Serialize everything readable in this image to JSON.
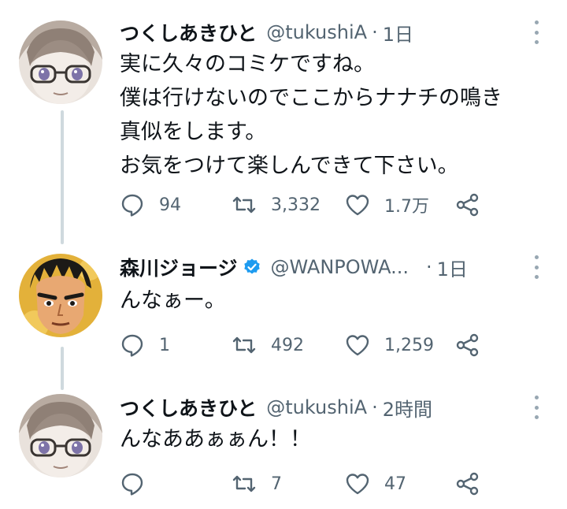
{
  "tweets": [
    {
      "name": "つくしあきひと",
      "handle": "@tukushiA",
      "time": "1日",
      "text": "実に久々のコミケですね。\n僕は行けないのでここからナナチの鳴き\n真似をします。\nお気をつけて楽しんできて下さい。",
      "reply_count": "94",
      "retweet_count": "3,332",
      "like_count": "1.7万",
      "verified": false,
      "avatar": "glasses-character-avatar"
    },
    {
      "name": "森川ジョージ",
      "handle": "@WANPOWA...",
      "time": "1日",
      "text": "んなぁー。",
      "reply_count": "1",
      "retweet_count": "492",
      "like_count": "1,259",
      "verified": true,
      "avatar": "boxer-character-avatar"
    },
    {
      "name": "つくしあきひと",
      "handle": "@tukushiA",
      "time": "2時間",
      "text": "んなああぁぁん！！",
      "reply_count": "",
      "retweet_count": "7",
      "like_count": "47",
      "verified": false,
      "avatar": "glasses-character-avatar"
    }
  ],
  "icons": {
    "reply": "reply-icon",
    "retweet": "retweet-icon",
    "like": "like-icon",
    "share": "share-icon",
    "more": "more-icon",
    "verified": "verified-badge-icon"
  },
  "colors": {
    "text_primary": "#0f1419",
    "text_secondary": "#536471",
    "thread_line": "#cfd9de",
    "verified_blue": "#1d9bf0"
  }
}
